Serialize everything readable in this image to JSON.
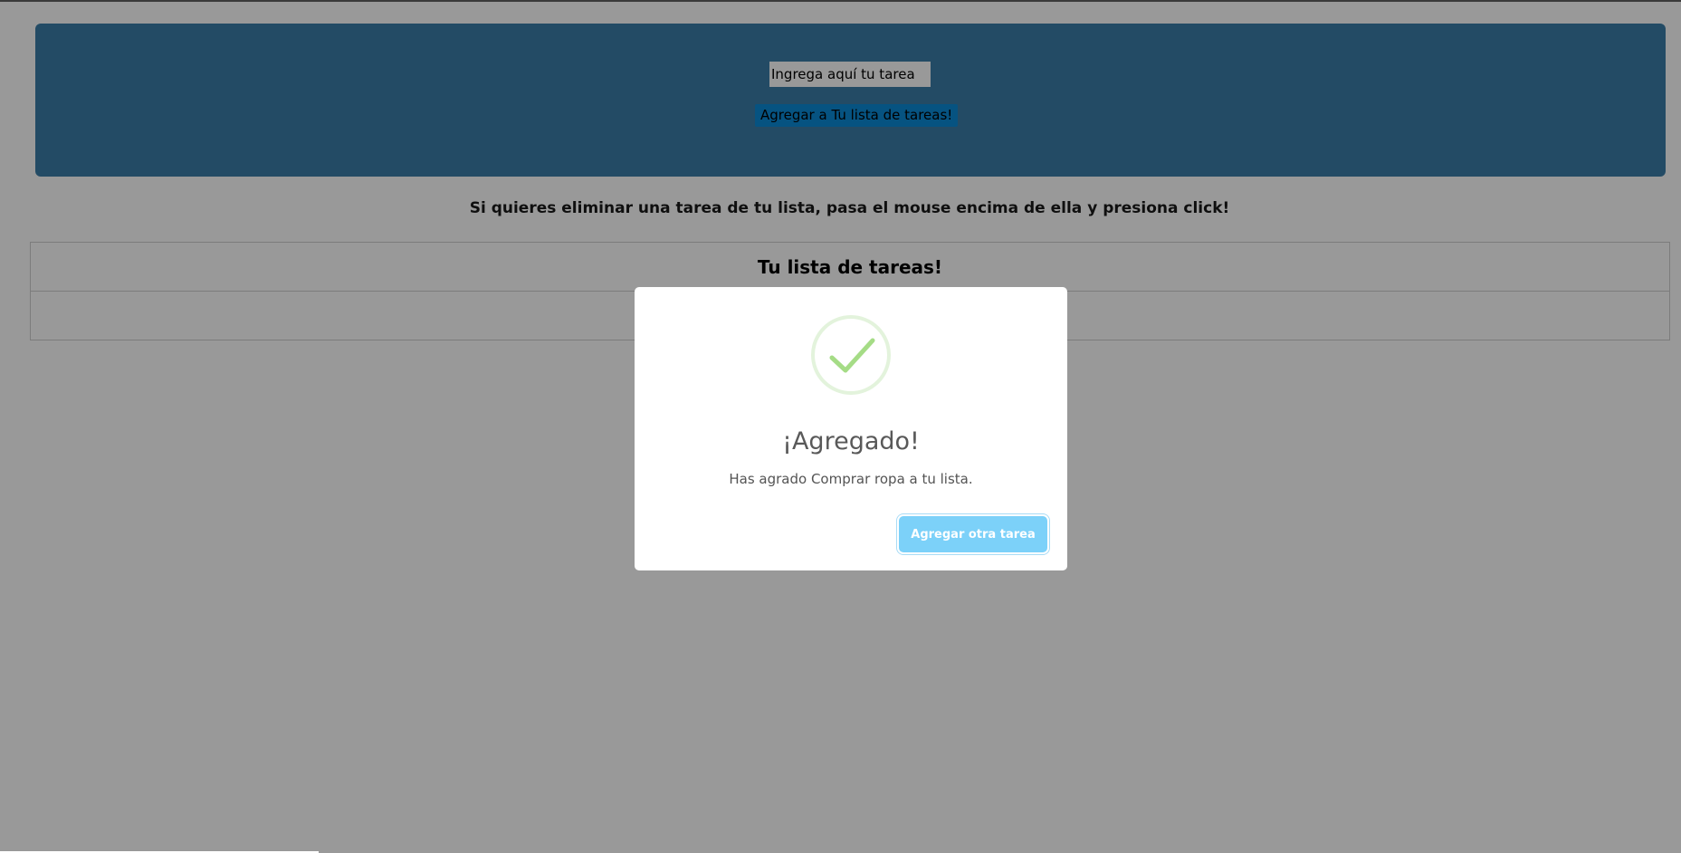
{
  "form": {
    "task_placeholder": "Ingrega aquí tu tarea",
    "add_button_label": "Agregar a Tu lista de tareas!"
  },
  "instructions": "Si quieres eliminar una tarea de tu lista, pasa el mouse encima de ella y presiona click!",
  "task_list": {
    "title": "Tu lista de tareas!",
    "items": []
  },
  "modal": {
    "icon": "check-icon",
    "title": "¡Agregado!",
    "text": "Has agrado Comprar ropa a tu lista.",
    "confirm_label": "Agregar otra tarea"
  },
  "colors": {
    "header_bg": "#3b7da8",
    "add_button_bg": "#0a8ad8",
    "success_green": "#a5dc86",
    "confirm_button_bg": "#7cd1f9"
  }
}
